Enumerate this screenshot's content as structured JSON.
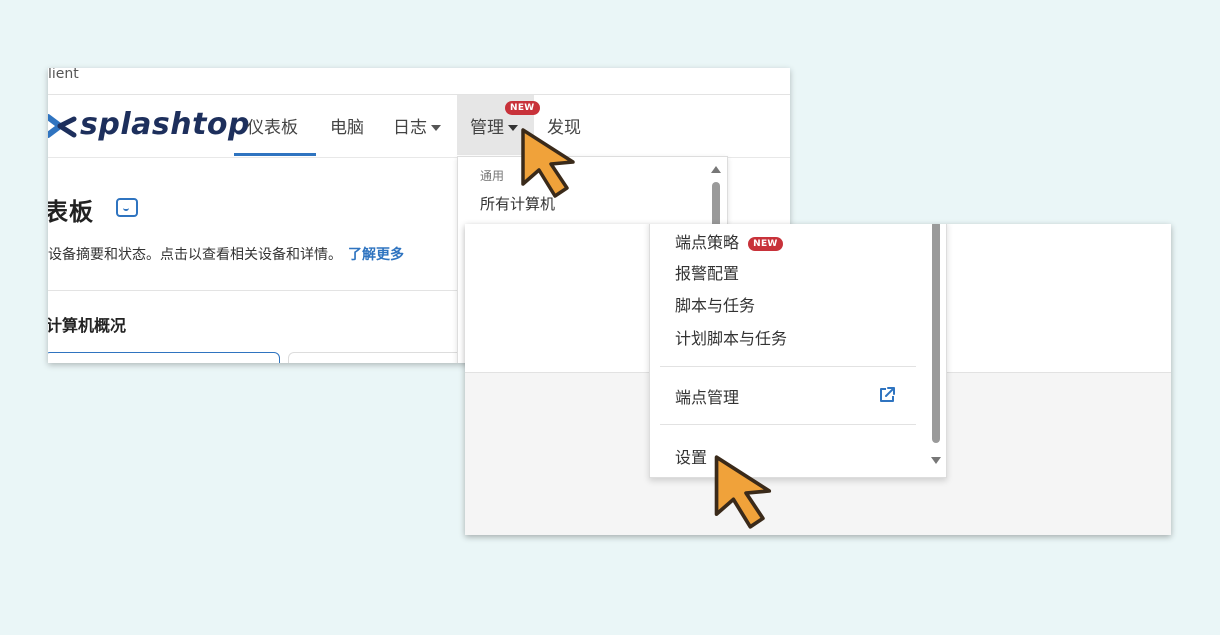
{
  "window": {
    "title": "lient"
  },
  "brand": {
    "name": "splashtop"
  },
  "nav": {
    "dashboard": "仪表板",
    "computers": "电脑",
    "logs": "日志",
    "manage": "管理",
    "manage_badge": "NEW",
    "discover": "发现"
  },
  "page": {
    "title": "表板",
    "description": "设备摘要和状态。点击以查看相关设备和详情。",
    "learn_more": "了解更多",
    "section_title": "计算机概况"
  },
  "manage_menu_top": {
    "group_label": "通用",
    "all_computers": "所有计算机"
  },
  "manage_menu_bottom": {
    "endpoint_policy": "端点策略",
    "endpoint_policy_badge": "NEW",
    "alert_config": "报警配置",
    "scripts_tasks": "脚本与任务",
    "scheduled_scripts_tasks": "计划脚本与任务",
    "endpoint_management": "端点管理",
    "settings": "设置"
  },
  "colors": {
    "accent": "#2f74c0",
    "badge": "#c8323a",
    "background": "#eaf6f7",
    "cursor_fill": "#f0a23a"
  },
  "icons": [
    "splashtop-logo-icon",
    "dashboard-help-icon",
    "external-link-icon",
    "cursor-arrow-icon"
  ]
}
